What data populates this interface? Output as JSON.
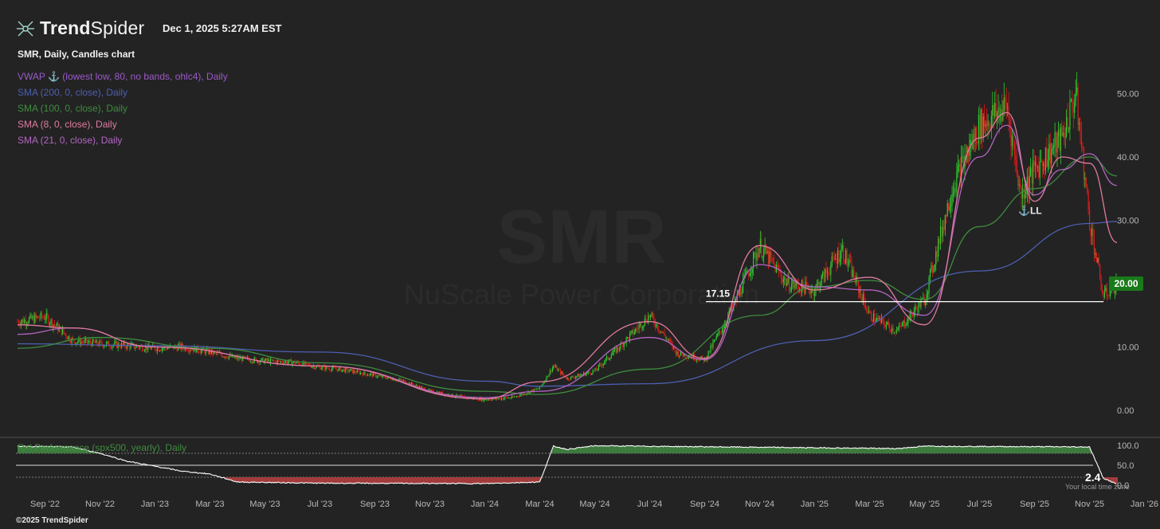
{
  "brand": {
    "name_bold": "Trend",
    "name_light": "Spider",
    "logo_icon": "trendspider-logo-icon"
  },
  "timestamp": "Dec 1, 2025 5:27AM EST",
  "chart_title": "SMR, Daily, Candles chart",
  "indicators": [
    {
      "label": "VWAP ⚓ (lowest low, 80, no bands, ohlc4), Daily",
      "color": "#9b59c9"
    },
    {
      "label": "SMA (200, 0, close), Daily",
      "color": "#4d5fb0"
    },
    {
      "label": "SMA (100, 0, close), Daily",
      "color": "#3e8c3e"
    },
    {
      "label": "SMA (8, 0, close), Daily",
      "color": "#e07aa0"
    },
    {
      "label": "SMA (21, 0, close), Daily",
      "color": "#b565c4"
    }
  ],
  "watermark": {
    "symbol": "SMR",
    "name": "NuScale Power Corporation"
  },
  "copyright": "©2025 TrendSpider",
  "chart_data": {
    "type": "candlestick",
    "symbol": "SMR",
    "interval": "Daily",
    "x_ticks": [
      "Sep '22",
      "Nov '22",
      "Jan '23",
      "Mar '23",
      "May '23",
      "Jul '23",
      "Sep '23",
      "Nov '23",
      "Jan '24",
      "Mar '24",
      "May '24",
      "Jul '24",
      "Sep '24",
      "Nov '24",
      "Jan '25",
      "Mar '25",
      "May '25",
      "Jul '25",
      "Sep '25",
      "Nov '25",
      "Jan '26"
    ],
    "y_ticks": [
      "0.00",
      "10.00",
      "20.00",
      "30.00",
      "40.00",
      "50.00"
    ],
    "y_range": [
      0,
      57
    ],
    "x_range": [
      "Aug '22",
      "Jan '26"
    ],
    "price_line": {
      "label": "17.15",
      "value": 17.15
    },
    "last_price": {
      "label": "20.00",
      "value": 20.0,
      "color": "#1a7a1a"
    },
    "anchor_marker": {
      "label": "⚓LL",
      "date": "Aug '25",
      "value": 31.5
    },
    "close_path": [
      [
        "Aug '22",
        14.0
      ],
      [
        "Sep '22",
        14.8
      ],
      [
        "Oct '22",
        11.0
      ],
      [
        "Nov '22",
        10.5
      ],
      [
        "Dec '22",
        10.2
      ],
      [
        "Jan '23",
        9.8
      ],
      [
        "Feb '23",
        10.0
      ],
      [
        "Mar '23",
        9.2
      ],
      [
        "Apr '23",
        8.2
      ],
      [
        "May '23",
        7.8
      ],
      [
        "Jun '23",
        7.6
      ],
      [
        "Jul '23",
        6.8
      ],
      [
        "Aug '23",
        6.3
      ],
      [
        "Sep '23",
        5.5
      ],
      [
        "Oct '23",
        4.7
      ],
      [
        "Nov '23",
        3.0
      ],
      [
        "Dec '23",
        2.2
      ],
      [
        "Jan '24",
        1.7
      ],
      [
        "Feb '24",
        2.0
      ],
      [
        "Mar '24",
        3.5
      ],
      [
        "Mar '24 b",
        7.0
      ],
      [
        "Apr '24",
        5.0
      ],
      [
        "May '24",
        6.2
      ],
      [
        "Jun '24",
        10.5
      ],
      [
        "Jul '24",
        15.0
      ],
      [
        "Aug '24",
        9.0
      ],
      [
        "Sep '24",
        8.0
      ],
      [
        "Oct '24",
        16.0
      ],
      [
        "Nov '24",
        26.0
      ],
      [
        "Dec '24",
        20.0
      ],
      [
        "Jan '25",
        19.0
      ],
      [
        "Feb '25",
        25.5
      ],
      [
        "Mar '25",
        15.0
      ],
      [
        "Apr '25",
        12.5
      ],
      [
        "May '25",
        17.5
      ],
      [
        "Jun '25",
        35.0
      ],
      [
        "Jul '25",
        45.0
      ],
      [
        "Aug '25",
        48.0
      ],
      [
        "Aug '25 b",
        34.0
      ],
      [
        "Sep '25",
        38.0
      ],
      [
        "Oct '25",
        43.0
      ],
      [
        "Oct '25 b",
        50.0
      ],
      [
        "Nov '25",
        30.0
      ],
      [
        "Nov '25 b",
        18.0
      ],
      [
        "Dec '25",
        20.0
      ]
    ],
    "series": [
      {
        "name": "SMA (200, 0, close), Daily",
        "color": "#4d5fb0",
        "values": [
          [
            "Aug '22",
            10.5
          ],
          [
            "Jan '23",
            10.2
          ],
          [
            "Jul '23",
            9.2
          ],
          [
            "Jan '24",
            4.6
          ],
          [
            "Mar '24",
            3.8
          ],
          [
            "Jul '24",
            4.2
          ],
          [
            "Jan '25",
            11.0
          ],
          [
            "Jul '25",
            22.0
          ],
          [
            "Nov '25",
            29.5
          ],
          [
            "Dec '25",
            29.8
          ]
        ]
      },
      {
        "name": "SMA (100, 0, close), Daily",
        "color": "#3e8c3e",
        "values": [
          [
            "Aug '22",
            9.8
          ],
          [
            "Nov '22",
            11.5
          ],
          [
            "Mar '23",
            9.8
          ],
          [
            "Jul '23",
            7.5
          ],
          [
            "Jan '24",
            3.0
          ],
          [
            "Mar '24",
            2.5
          ],
          [
            "Jul '24",
            6.5
          ],
          [
            "Nov '24",
            15.0
          ],
          [
            "Jan '25",
            19.5
          ],
          [
            "Mar '25",
            20.5
          ],
          [
            "May '25",
            17.5
          ],
          [
            "Jul '25",
            29.0
          ],
          [
            "Sep '25",
            35.0
          ],
          [
            "Nov '25",
            40.0
          ],
          [
            "Dec '25",
            37.0
          ]
        ]
      },
      {
        "name": "SMA (21, 0, close), Daily",
        "color": "#b565c4",
        "values": [
          [
            "Aug '22",
            12.0
          ],
          [
            "Oct '22",
            13.0
          ],
          [
            "Jan '23",
            10.0
          ],
          [
            "Jul '23",
            7.0
          ],
          [
            "Jan '24",
            2.0
          ],
          [
            "Mar '24",
            3.0
          ],
          [
            "Jul '24",
            11.5
          ],
          [
            "Sep '24",
            8.0
          ],
          [
            "Nov '24",
            23.0
          ],
          [
            "Jan '25",
            19.5
          ],
          [
            "Mar '25",
            19.0
          ],
          [
            "May '25",
            15.0
          ],
          [
            "Jul '25",
            40.0
          ],
          [
            "Aug '25",
            45.0
          ],
          [
            "Sep '25",
            34.0
          ],
          [
            "Oct '25",
            38.0
          ],
          [
            "Nov '25",
            40.5
          ],
          [
            "Dec '25",
            35.5
          ]
        ]
      },
      {
        "name": "SMA (8, 0, close), Daily",
        "color": "#e07aa0",
        "values": [
          [
            "Aug '22",
            13.5
          ],
          [
            "Oct '22",
            13.0
          ],
          [
            "Jan '23",
            10.0
          ],
          [
            "Jul '23",
            7.0
          ],
          [
            "Jan '24",
            1.8
          ],
          [
            "Mar '24",
            4.5
          ],
          [
            "Jul '24",
            14.0
          ],
          [
            "Sep '24",
            8.2
          ],
          [
            "Nov '24",
            26.0
          ],
          [
            "Jan '25",
            19.0
          ],
          [
            "Mar '25",
            21.0
          ],
          [
            "May '25",
            13.5
          ],
          [
            "Jul '25",
            43.0
          ],
          [
            "Aug '25",
            47.0
          ],
          [
            "Sep '25",
            33.0
          ],
          [
            "Oct '25",
            40.0
          ],
          [
            "Nov '25",
            39.0
          ],
          [
            "Dec '25",
            26.5
          ]
        ]
      }
    ],
    "sub_panel": {
      "label": "Rel Performance (spx500, yearly), Daily",
      "y_ticks": [
        "100.0",
        "50.0",
        "0.0"
      ],
      "current_value": "2.4",
      "note": "Your local time zone",
      "overbought": 80,
      "middle": 50,
      "oversold": 20,
      "values": [
        [
          "Aug '22",
          98
        ],
        [
          "Oct '22",
          96
        ],
        [
          "Nov '22",
          80
        ],
        [
          "Dec '22",
          60
        ],
        [
          "Feb '23",
          35
        ],
        [
          "Mar '23",
          28
        ],
        [
          "Apr '23",
          8
        ],
        [
          "Jul '23",
          5
        ],
        [
          "Jan '24",
          4
        ],
        [
          "Mar '24",
          8
        ],
        [
          "Mar '24 b",
          98
        ],
        [
          "Apr '24",
          90
        ],
        [
          "May '24",
          99
        ],
        [
          "Apr '25",
          92
        ],
        [
          "May '25",
          98
        ],
        [
          "Nov '25",
          96
        ],
        [
          "Nov '25 b",
          18
        ],
        [
          "Dec '25",
          2.4
        ]
      ]
    }
  }
}
